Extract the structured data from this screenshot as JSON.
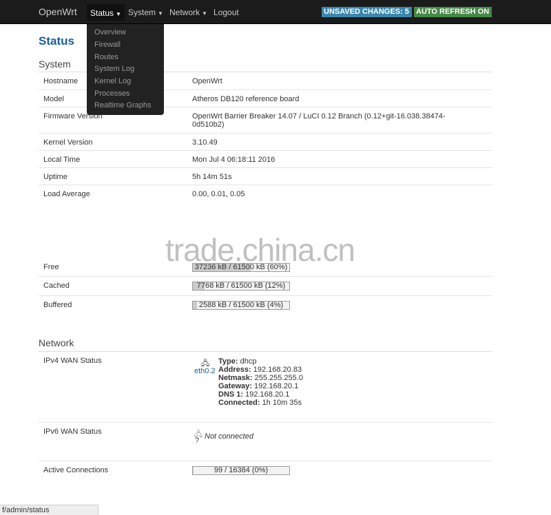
{
  "nav": {
    "brand": "OpenWrt",
    "status": "Status",
    "system": "System",
    "network": "Network",
    "logout": "Logout",
    "unsaved": "UNSAVED CHANGES: 5",
    "autorefresh": "AUTO REFRESH ON"
  },
  "dropdown": [
    "Overview",
    "Firewall",
    "Routes",
    "System Log",
    "Kernel Log",
    "Processes",
    "Realtime Graphs"
  ],
  "page_title": "Status",
  "system": {
    "title": "System",
    "rows": [
      {
        "label": "Hostname",
        "value": "OpenWrt"
      },
      {
        "label": "Model",
        "value": "Atheros DB120 reference board"
      },
      {
        "label": "Firmware Version",
        "value": "OpenWrt Barrier Breaker 14.07 / LuCI 0.12 Branch (0.12+git-16.038.38474-0d510b2)"
      },
      {
        "label": "Kernel Version",
        "value": "3.10.49"
      },
      {
        "label": "Local Time",
        "value": "Mon Jul 4 06:18:11 2016"
      },
      {
        "label": "Uptime",
        "value": "5h 14m 51s"
      },
      {
        "label": "Load Average",
        "value": "0.00, 0.01, 0.05"
      }
    ]
  },
  "memory": {
    "rows": [
      {
        "label": "Free",
        "value": "37236 kB / 61500 kB (60%)",
        "fraction": 0.6
      },
      {
        "label": "Cached",
        "value": "7768 kB / 61500 kB (12%)",
        "fraction": 0.12
      },
      {
        "label": "Buffered",
        "value": "2588 kB / 61500 kB (4%)",
        "fraction": 0.04
      }
    ]
  },
  "network": {
    "title": "Network",
    "ipv4_label": "IPv4 WAN Status",
    "ipv4_iface": "eth0.2",
    "ipv4_icon": "network-port-icon",
    "ipv4": {
      "type_k": "Type:",
      "type_v": "dhcp",
      "address_k": "Address:",
      "address_v": "192.168.20.83",
      "netmask_k": "Netmask:",
      "netmask_v": "255.255.255.0",
      "gateway_k": "Gateway:",
      "gateway_v": "192.168.20.1",
      "dns_k": "DNS 1:",
      "dns_v": "192.168.20.1",
      "connected_k": "Connected:",
      "connected_v": "1h 10m 35s"
    },
    "ipv6_label": "IPv6 WAN Status",
    "ipv6_value": "Not connected",
    "ipv6_q": "?",
    "active_label": "Active Connections",
    "active_value": "99 / 16384 (0%)",
    "active_fraction": 0.006
  },
  "statusbar_url": "f/admin/status",
  "watermark": "trade.china.cn"
}
